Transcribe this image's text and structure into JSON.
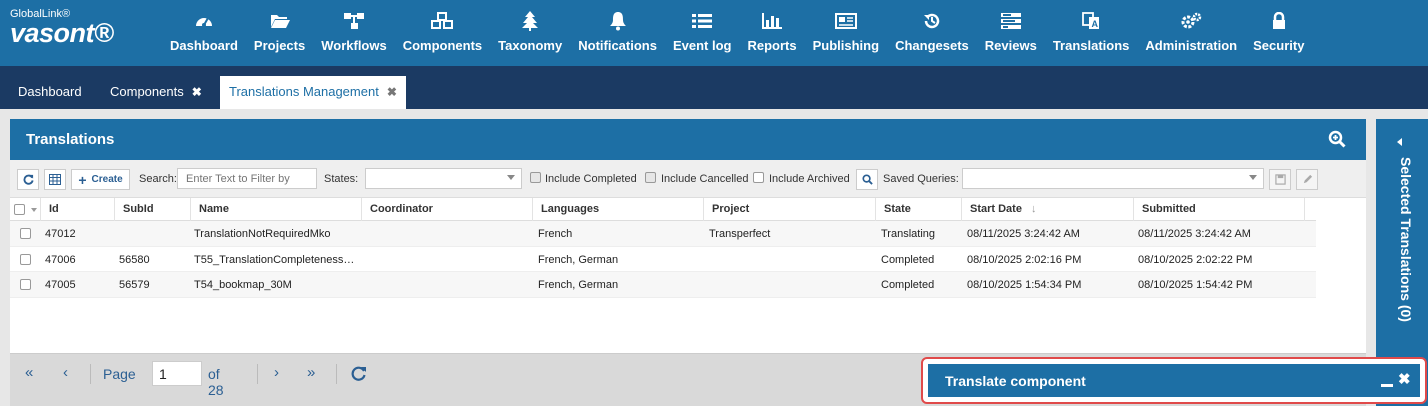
{
  "logo": {
    "top": "GlobalLink®",
    "main": "vasont®"
  },
  "nav": [
    {
      "label": "Dashboard",
      "icon": "dashboard-icon"
    },
    {
      "label": "Projects",
      "icon": "folder-open-icon"
    },
    {
      "label": "Workflows",
      "icon": "workflow-icon"
    },
    {
      "label": "Components",
      "icon": "cubes-icon"
    },
    {
      "label": "Taxonomy",
      "icon": "tree-icon"
    },
    {
      "label": "Notifications",
      "icon": "bell-icon"
    },
    {
      "label": "Event log",
      "icon": "list-icon"
    },
    {
      "label": "Reports",
      "icon": "bar-chart-icon"
    },
    {
      "label": "Publishing",
      "icon": "newspaper-icon"
    },
    {
      "label": "Changesets",
      "icon": "history-icon"
    },
    {
      "label": "Reviews",
      "icon": "tasks-icon"
    },
    {
      "label": "Translations",
      "icon": "translate-icon"
    },
    {
      "label": "Administration",
      "icon": "gears-icon"
    },
    {
      "label": "Security",
      "icon": "lock-icon"
    }
  ],
  "tabs": [
    {
      "label": "Dashboard",
      "closable": false
    },
    {
      "label": "Components",
      "closable": true
    },
    {
      "label": "Translations Management",
      "closable": true,
      "active": true
    }
  ],
  "panel": {
    "title": "Translations"
  },
  "toolbar": {
    "create_label": "Create",
    "search_label": "Search:",
    "search_placeholder": "Enter Text to Filter by",
    "states_label": "States:",
    "include_completed": "Include Completed",
    "include_cancelled": "Include Cancelled",
    "include_archived": "Include Archived",
    "saved_queries_label": "Saved Queries:"
  },
  "grid": {
    "columns": [
      "Id",
      "SubId",
      "Name",
      "Coordinator",
      "Languages",
      "Project",
      "State",
      "Start Date",
      "Submitted"
    ],
    "rows": [
      {
        "id": "47012",
        "subid": "",
        "name": "TranslationNotRequiredMko",
        "coordinator": "",
        "languages": "French",
        "project": "Transperfect",
        "state": "Translating",
        "start": "08/11/2025 3:24:42 AM",
        "submitted": "08/11/2025 3:24:42 AM"
      },
      {
        "id": "47006",
        "subid": "56580",
        "name": "T55_TranslationCompletenessR...",
        "coordinator": "",
        "languages": "French, German",
        "project": "",
        "state": "Completed",
        "start": "08/10/2025 2:02:16 PM",
        "submitted": "08/10/2025 2:02:22 PM"
      },
      {
        "id": "47005",
        "subid": "56579",
        "name": "T54_bookmap_30M",
        "coordinator": "",
        "languages": "French, German",
        "project": "",
        "state": "Completed",
        "start": "08/10/2025 1:54:34 PM",
        "submitted": "08/10/2025 1:54:42 PM"
      }
    ]
  },
  "pager": {
    "page_label": "Page",
    "page_value": "1",
    "of_label": "of 28"
  },
  "sidepanel": {
    "label": "Selected Translations (0)"
  },
  "popup": {
    "title": "Translate component"
  },
  "colors": {
    "primary": "#1d6fa5",
    "tabbar": "#1b3a63",
    "highlight": "#e04a4a"
  }
}
